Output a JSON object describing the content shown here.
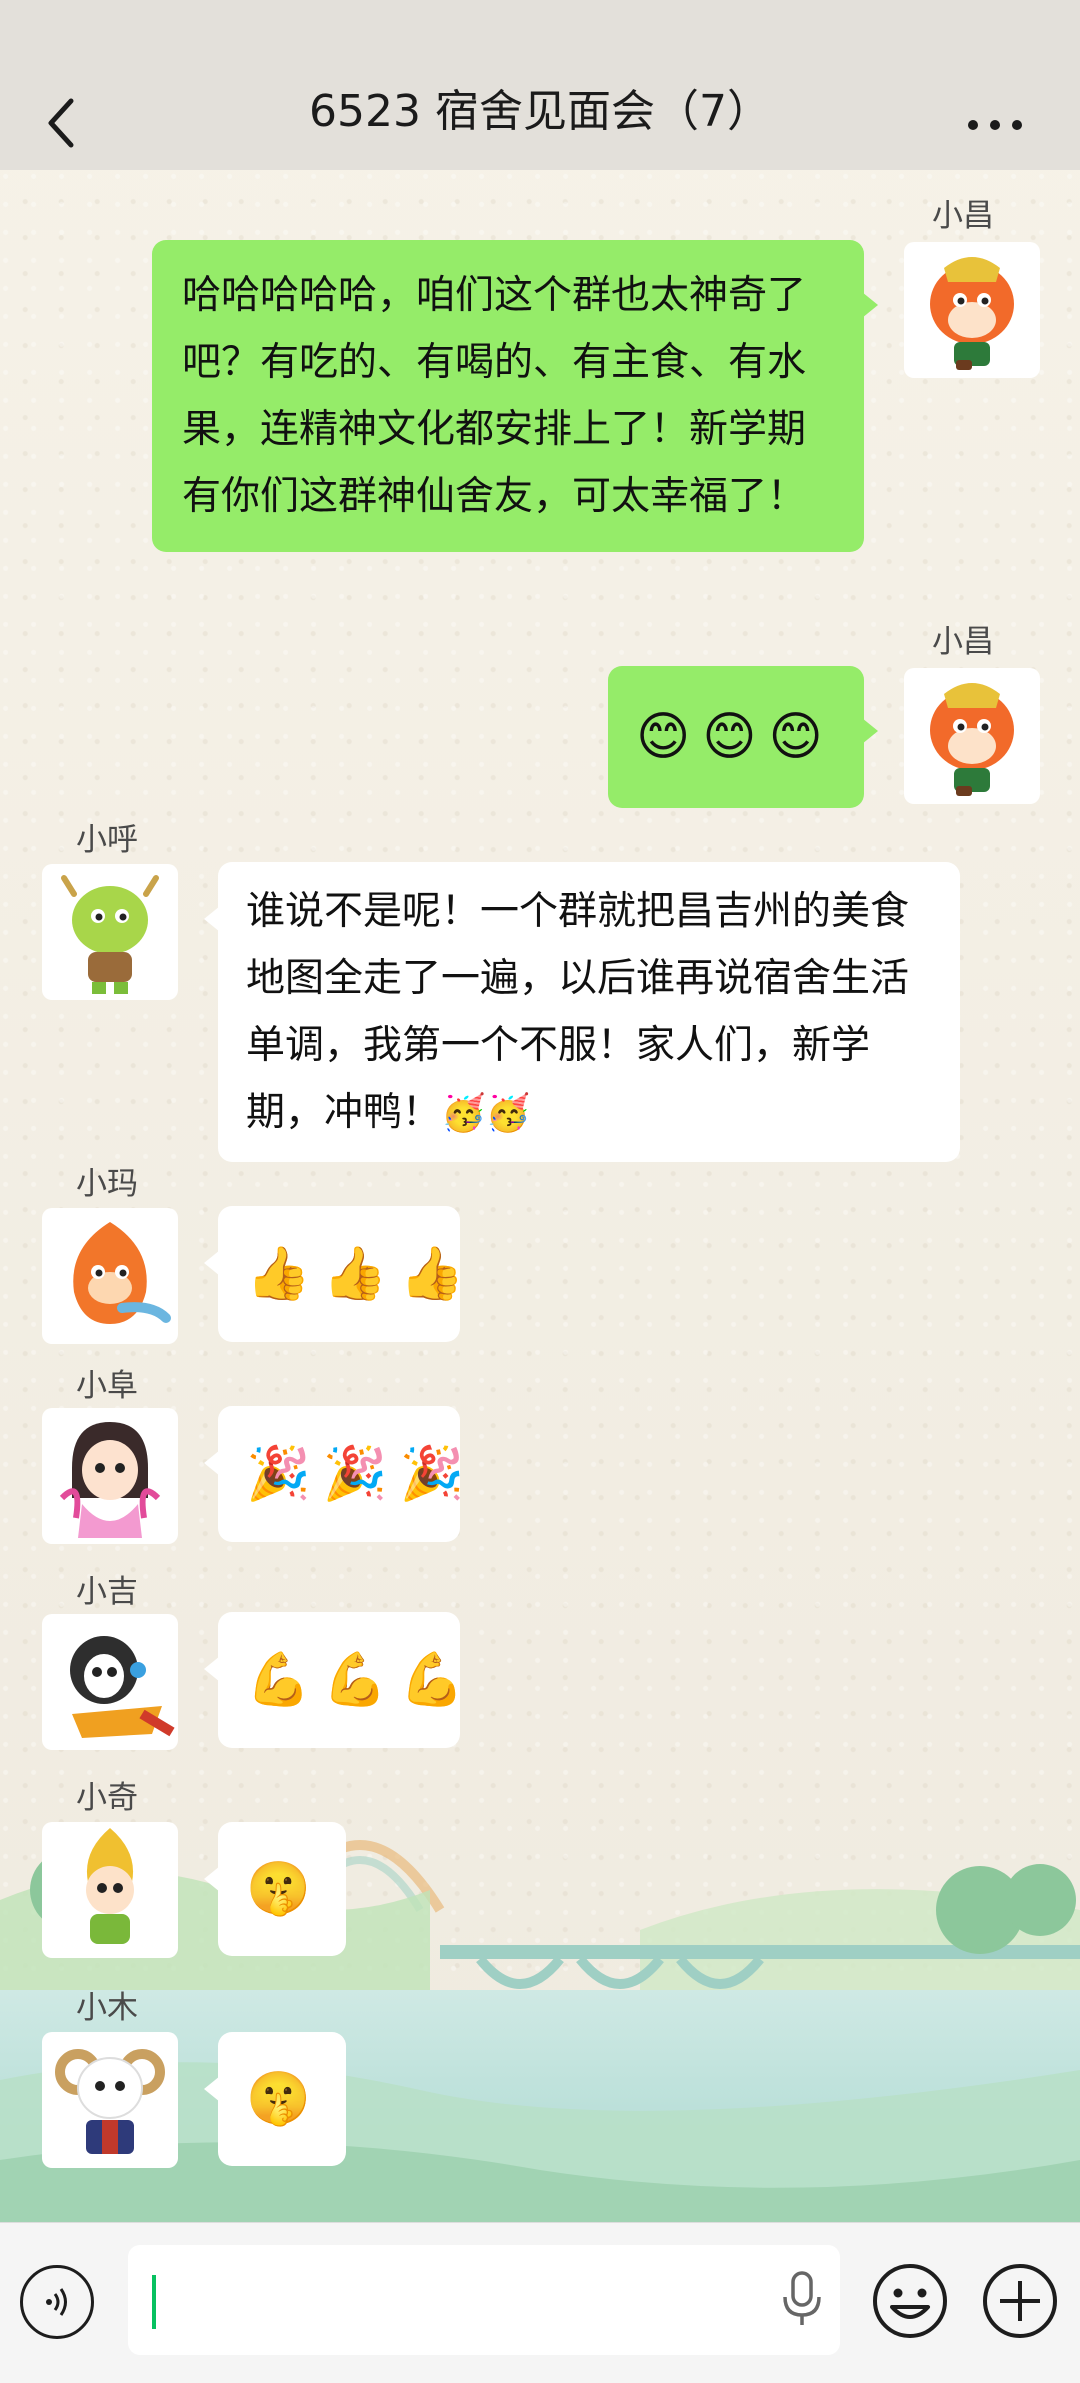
{
  "header": {
    "title": "6523 宿舍见面会（7）"
  },
  "messages": [
    {
      "sender": "小昌",
      "side": "right",
      "text": "哈哈哈哈哈，咱们这个群也太神奇了吧？有吃的、有喝的、有主食、有水果，连精神文化都安排上了！新学期有你们这群神仙舍友，可太幸福了！"
    },
    {
      "sender": "小昌",
      "side": "right",
      "emojis": [
        "😊",
        "😊",
        "😊"
      ]
    },
    {
      "sender": "小呼",
      "side": "left",
      "text": "谁说不是呢！一个群就把昌吉州的美食地图全走了一遍，以后谁再说宿舍生活单调，我第一个不服！家人们，新学期，冲鸭！",
      "emojis": [
        "🥳",
        "🥳"
      ]
    },
    {
      "sender": "小玛",
      "side": "left",
      "emojis": [
        "👍",
        "👍",
        "👍"
      ]
    },
    {
      "sender": "小阜",
      "side": "left",
      "emojis": [
        "🎉",
        "🎉",
        "🎉"
      ]
    },
    {
      "sender": "小吉",
      "side": "left",
      "emojis": [
        "💪",
        "💪",
        "💪"
      ]
    },
    {
      "sender": "小奇",
      "side": "left",
      "emojis": [
        "🤫"
      ]
    },
    {
      "sender": "小木",
      "side": "left",
      "emojis": [
        "🤫"
      ]
    }
  ],
  "input": {
    "placeholder": ""
  },
  "colors": {
    "bubble_self": "#95ec69",
    "bubble_other": "#ffffff",
    "header_bg": "#e3e0da",
    "accent": "#07c160"
  }
}
